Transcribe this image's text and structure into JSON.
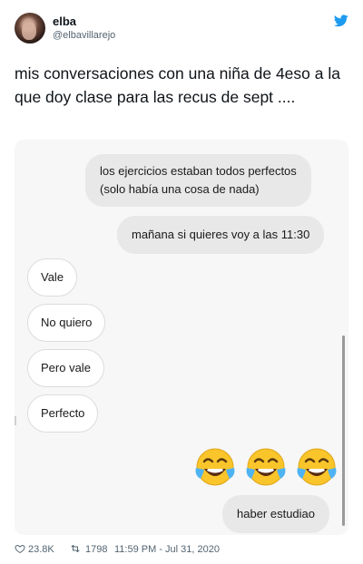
{
  "author": {
    "name": "elba",
    "handle": "@elbavillarejo",
    "avatar_icon": "profile-photo",
    "platform_icon": "twitter-bird-icon"
  },
  "tweet": {
    "text": "mis conversaciones con una niña de 4eso a la que doy clase para las recus de sept ...."
  },
  "chat": {
    "messages": [
      {
        "direction": "out",
        "lines": [
          "los ejercicios estaban todos perfectos",
          "(solo había una cosa de nada)"
        ]
      },
      {
        "direction": "out",
        "lines": [
          "mañana si quieres voy a las 11:30"
        ]
      },
      {
        "direction": "in",
        "lines": [
          "Vale"
        ]
      },
      {
        "direction": "in",
        "lines": [
          "No quiero"
        ]
      },
      {
        "direction": "in",
        "lines": [
          "Pero vale"
        ]
      },
      {
        "direction": "in",
        "lines": [
          "Perfecto"
        ]
      },
      {
        "direction": "out",
        "emoji": "face-with-tears-of-joy",
        "count": 3
      },
      {
        "direction": "out",
        "lines": [
          "haber estudiao"
        ]
      }
    ]
  },
  "stats": {
    "likes": "23.8K",
    "retweets": "1798",
    "timestamp": "11:59 PM - Jul 31, 2020"
  },
  "colors": {
    "twitter_blue": "#1d9bf0",
    "muted_text": "#536471",
    "bubble_out": "#e8e8e8",
    "bubble_in_border": "#dcdcdc"
  }
}
